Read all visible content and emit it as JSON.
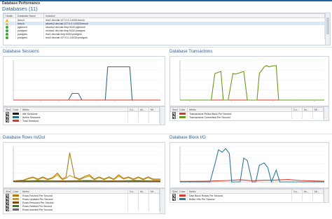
{
  "app": {
    "title": "Database Performance"
  },
  "databases": {
    "title": "Databases (11)",
    "columns": [
      "Health",
      "Database Name",
      "Instance"
    ],
    "rows": [
      {
        "status": "warning",
        "name": "bench",
        "instance": "rhel1.dev.lab:127.0.0.1:5432:bench"
      },
      {
        "status": "warning",
        "name": "bench",
        "instance": "ubuntu2.dev.lab:127.0.0.1:5433:bench",
        "selected": true
      },
      {
        "status": "ok",
        "name": "pgbench",
        "instance": "ubuntu2.dev.lab:/tmp:5432:pgbench"
      },
      {
        "status": "ok",
        "name": "postgres",
        "instance": "centos1.dev.lab:/tmp:5432:postgres"
      },
      {
        "status": "ok",
        "name": "postgres",
        "instance": "rhel1.dev.lab:/tmp:5432:postgres"
      },
      {
        "status": "ok",
        "name": "postgres",
        "instance": "rhel2.dev.lab:127.0.0.1:5433:postgres"
      }
    ]
  },
  "legend_columns": [
    "Show",
    "Color",
    "Metric",
    "Cu...",
    "Av...",
    "Mi..."
  ],
  "panels": [
    {
      "title": "Database Sessions",
      "ticks": [
        "",
        "",
        "",
        "",
        "",
        "",
        "",
        ""
      ],
      "ylim": [
        0,
        6
      ],
      "series": [
        {
          "name": "Idle Sessions",
          "color": "#1a1a1a",
          "x": [
            0,
            5,
            7,
            9,
            10.5,
            11,
            12
          ],
          "y": [
            0,
            0,
            0,
            0,
            0,
            0,
            0
          ]
        },
        {
          "name": "Active Sessions",
          "color": "#2a6f86",
          "x": [
            0,
            4.5,
            4.8,
            5.3,
            5.6,
            7.5,
            7.7,
            9.5,
            9.7,
            12
          ],
          "y": [
            0,
            0,
            1,
            1,
            0,
            0,
            5,
            5,
            0,
            0
          ]
        },
        {
          "name": "Total Sessions",
          "color": "#d83a2a",
          "x": [
            0,
            12
          ],
          "y": [
            0,
            0
          ]
        }
      ]
    },
    {
      "title": "Database Transactions",
      "ticks": [
        "",
        "",
        "",
        "",
        "",
        "",
        ""
      ],
      "ylim": [
        0,
        6
      ],
      "series": [
        {
          "name": "Transactions Rolled Back Per Second",
          "color": "#d83a2a",
          "x": [
            0,
            12
          ],
          "y": [
            0,
            0
          ]
        },
        {
          "name": "Transactions Committed Per Second",
          "color": "#6a9a1a",
          "x": [
            0,
            2.6,
            2.9,
            3.4,
            3.6,
            4.0,
            4.4,
            4.6,
            5.3,
            5.6,
            6.4,
            6.6,
            7.0,
            7.2,
            7.4,
            7.6,
            8.0,
            8.2,
            9.0,
            9.2,
            12
          ],
          "y": [
            0,
            0,
            4,
            4.3,
            0,
            0,
            4,
            3.9,
            4.3,
            0,
            0,
            4,
            5,
            5.2,
            5,
            5.1,
            5.2,
            0,
            0,
            0,
            0
          ]
        }
      ]
    },
    {
      "title": "Database Rows In/Out",
      "ticks": [
        "",
        "",
        "",
        "",
        "",
        "",
        ""
      ],
      "ylim": [
        0,
        100
      ],
      "series": [
        {
          "name": "Rows Fetched Per Second",
          "color": "#b07a10",
          "x": [
            0,
            0.8,
            1.2,
            1.6,
            2,
            2.4,
            2.8,
            3.2,
            3.6,
            4,
            4.3,
            4.6,
            5,
            5.4,
            5.8,
            6.2,
            6.6,
            7,
            7.4,
            7.8,
            8.2,
            8.6,
            9,
            9.4,
            9.8,
            10.2,
            10.6,
            11,
            11.4,
            12
          ],
          "y": [
            3,
            5,
            10,
            14,
            8,
            14,
            8,
            12,
            25,
            8,
            14,
            82,
            14,
            8,
            15,
            20,
            8,
            14,
            8,
            14,
            8,
            20,
            10,
            14,
            8,
            14,
            8,
            14,
            8,
            8
          ]
        },
        {
          "name": "Rows Updated Per Second",
          "color": "#c49a20",
          "x": [
            0,
            0.8,
            1.2,
            1.6,
            2,
            2.4,
            2.8,
            3.2,
            3.6,
            4,
            4.3,
            4.6,
            5,
            5.4,
            5.8,
            6.2,
            6.6,
            7,
            7.4,
            7.8,
            8.2,
            8.6,
            9,
            9.4,
            9.8,
            10.2,
            10.6,
            11,
            11.4,
            12
          ],
          "y": [
            2,
            3,
            8,
            12,
            6,
            12,
            6,
            10,
            20,
            6,
            10,
            18,
            12,
            6,
            12,
            16,
            6,
            12,
            6,
            12,
            6,
            16,
            8,
            12,
            6,
            12,
            6,
            12,
            6,
            6
          ]
        },
        {
          "name": "Rows Returned Per Second",
          "color": "#7a4a10",
          "x": [
            0,
            2,
            4,
            6,
            8,
            10,
            12
          ],
          "y": [
            2,
            4,
            3,
            4,
            3,
            4,
            3
          ]
        },
        {
          "name": "Rows Deleted Per Second",
          "color": "#3a7a20",
          "x": [
            0,
            2,
            4,
            6,
            8,
            10,
            12
          ],
          "y": [
            1,
            2,
            1,
            2,
            1,
            2,
            1
          ]
        },
        {
          "name": "Rows Inserted Per Second",
          "color": "#6a6a6a",
          "x": [
            0,
            12
          ],
          "y": [
            0,
            0
          ]
        }
      ]
    },
    {
      "title": "Database Block I/O",
      "ticks": [
        "",
        "",
        "",
        "",
        "",
        "",
        ""
      ],
      "ylim": [
        0,
        3000
      ],
      "series": [
        {
          "name": "Disk Block Reads Per Second",
          "color": "#d83a2a",
          "x": [
            0,
            2,
            3,
            4,
            5,
            6,
            7,
            8,
            9,
            10,
            11,
            12
          ],
          "y": [
            40,
            60,
            80,
            120,
            180,
            100,
            140,
            160,
            200,
            120,
            80,
            60
          ]
        },
        {
          "name": "Buffer Hits Per Second",
          "color": "#2a7aa0",
          "x": [
            0,
            2.5,
            2.9,
            3.2,
            3.5,
            3.8,
            4.1,
            4.3,
            4.6,
            5.0,
            5.3,
            5.6,
            6.0,
            6.3,
            6.6,
            7.0,
            7.3,
            7.6,
            8.0,
            8.3,
            9.0,
            9.3,
            12
          ],
          "y": [
            0,
            0,
            1500,
            2700,
            2500,
            2800,
            2400,
            0,
            0,
            0,
            2000,
            1800,
            0,
            0,
            1400,
            1600,
            1200,
            0,
            1000,
            0,
            0,
            0,
            0
          ]
        }
      ]
    }
  ]
}
